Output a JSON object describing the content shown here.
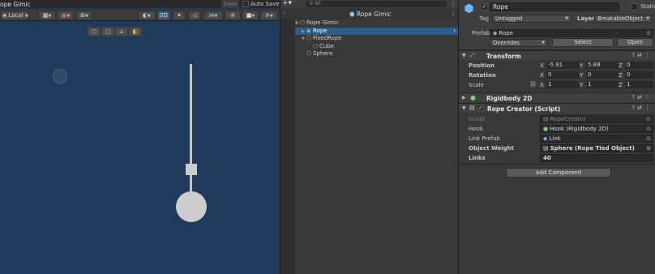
{
  "scene": {
    "title": "ope Gimic",
    "save_label": "Save",
    "autosave_label": "Auto Save",
    "pivot_label": "Local",
    "mode_2d": "2D"
  },
  "hierarchy": {
    "search_placeholder": "All",
    "scene_name": "Rope Gimic",
    "items": [
      {
        "label": "Rope Gimic",
        "indent": 0,
        "expanded": true,
        "icon": "gameobject-icon",
        "selected": false
      },
      {
        "label": "Rope",
        "indent": 1,
        "expanded": false,
        "icon": "prefab-icon",
        "selected": true
      },
      {
        "label": "FixedRope",
        "indent": 1,
        "expanded": true,
        "icon": "gameobject-icon",
        "selected": false
      },
      {
        "label": "Cube",
        "indent": 2,
        "expanded": null,
        "icon": "gameobject-icon",
        "selected": false
      },
      {
        "label": "Sphere",
        "indent": 1,
        "expanded": null,
        "icon": "gameobject-icon",
        "selected": false
      }
    ]
  },
  "inspector": {
    "object_name": "Rope",
    "static_label": "Static",
    "tag_label": "Tag",
    "tag_value": "Untagged",
    "layer_label": "Layer",
    "layer_value": "BreakableObject",
    "prefab_label": "Prefab",
    "prefab_value": "Rope",
    "overrides_label": "Overrides",
    "select_label": "Select",
    "open_label": "Open",
    "transform": {
      "title": "Transform",
      "position_label": "Position",
      "rotation_label": "Rotation",
      "scale_label": "Scale",
      "position": {
        "x": "-5.91",
        "y": "5.88",
        "z": "0"
      },
      "rotation": {
        "x": "0",
        "y": "0",
        "z": "0"
      },
      "scale": {
        "x": "1",
        "y": "1",
        "z": "1"
      }
    },
    "rigidbody_title": "Rigidbody 2D",
    "rope_creator": {
      "title": "Rope Creator (Script)",
      "script_label": "Script",
      "script_value": "RopeCreator",
      "hook_label": "Hook",
      "hook_value": "Hook (Rigidbody 2D)",
      "link_prefab_label": "Link Prefab",
      "link_prefab_value": "Link",
      "object_weight_label": "Object Weight",
      "object_weight_value": "Sphere (Rope Tied Object)",
      "links_label": "Links",
      "links_value": "40"
    },
    "add_component_label": "Add Component"
  },
  "colors": {
    "scene_bg": "#1f3a5a",
    "selection": "#2c5d87",
    "panel_bg": "#383838",
    "accent_blue": "#68b7ff"
  }
}
